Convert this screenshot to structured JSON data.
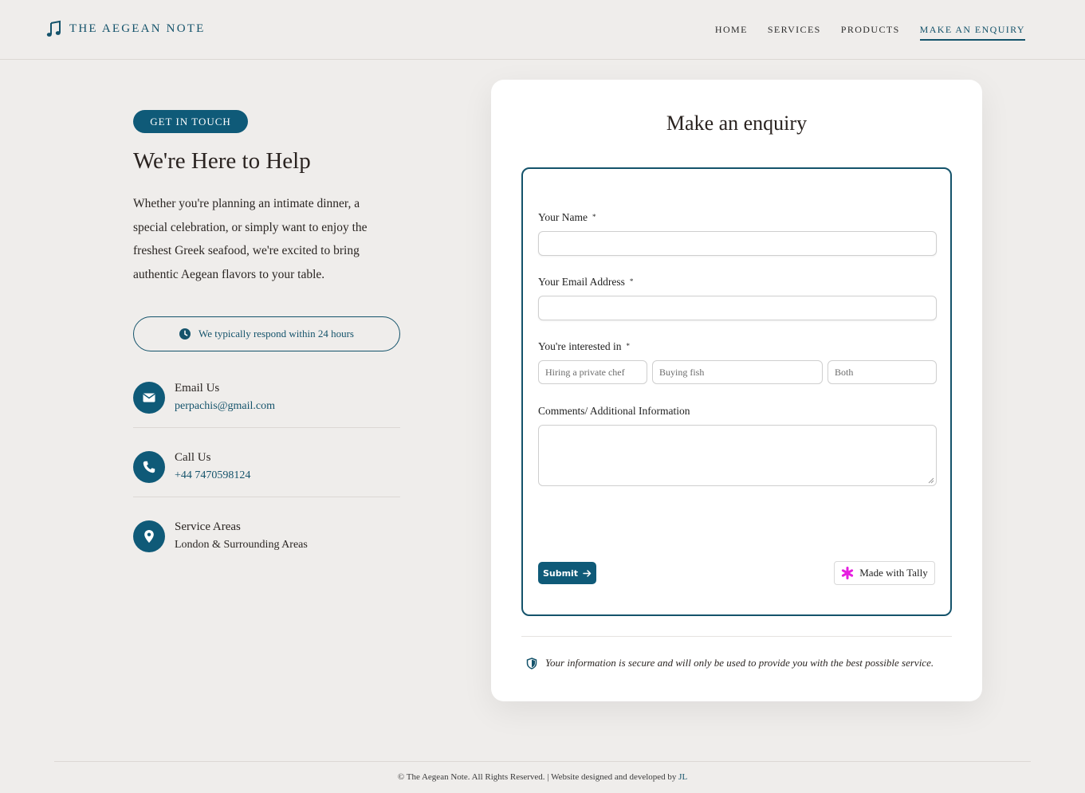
{
  "brand": {
    "name": "THE AEGEAN NOTE",
    "color": "#14536b"
  },
  "nav": {
    "items": [
      {
        "label": "HOME"
      },
      {
        "label": "SERVICES"
      },
      {
        "label": "PRODUCTS"
      },
      {
        "label": "MAKE AN ENQUIRY",
        "active": true
      }
    ]
  },
  "left": {
    "badge": "GET IN TOUCH",
    "heading": "We're Here to Help",
    "intro": "Whether you're planning an intimate dinner, a special celebration, or simply want to enjoy the freshest Greek seafood, we're excited to bring authentic Aegean flavors to your table.",
    "respond": "We typically respond within 24 hours",
    "contacts": [
      {
        "title": "Email Us",
        "value": "perpachis@gmail.com",
        "icon": "envelope-icon"
      },
      {
        "title": "Call Us",
        "value": "+44 7470598124",
        "icon": "phone-icon"
      },
      {
        "title": "Service Areas",
        "value": "London & Surrounding Areas",
        "icon": "map-pin-icon"
      }
    ]
  },
  "card": {
    "title": "Make an enquiry",
    "form": {
      "name_label": "Your Name",
      "email_label": "Your Email Address",
      "interest_label": "You're interested in",
      "required_mark": "*",
      "options": [
        "Hiring a private chef",
        "Buying fish",
        "Both"
      ],
      "comments_label": "Comments/ Additional Information",
      "submit_label": "Submit",
      "tally_label": "Made with Tally"
    },
    "secure_note": "Your information is secure and will only be used to provide you with the best possible service."
  },
  "footer": {
    "text": "©  The Aegean Note. All Rights Reserved. | Website designed and developed by ",
    "credit": "JL"
  }
}
